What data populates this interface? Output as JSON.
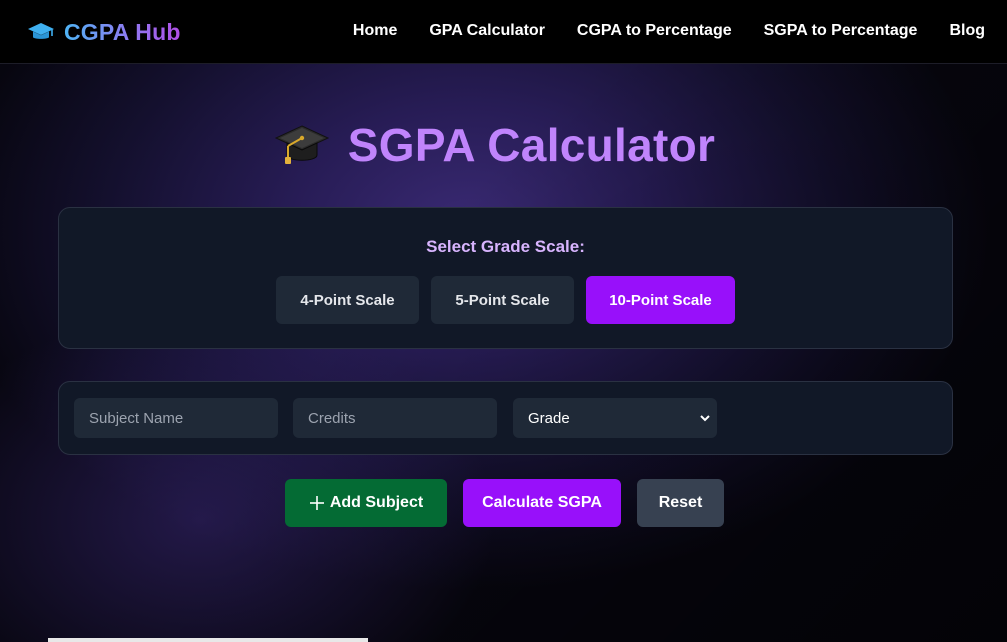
{
  "navbar": {
    "brand": "CGPA Hub",
    "brand_icon": "graduation-cap-icon",
    "links": [
      "Home",
      "GPA Calculator",
      "CGPA to Percentage",
      "SGPA to Percentage",
      "Blog"
    ]
  },
  "heading": {
    "icon": "graduation-cap-emoji-icon",
    "title": "SGPA Calculator"
  },
  "grade_scale": {
    "label": "Select Grade Scale:",
    "options": [
      "4-Point Scale",
      "5-Point Scale",
      "10-Point Scale"
    ],
    "selected": "10-Point Scale"
  },
  "subject_form": {
    "subject_placeholder": "Subject Name",
    "credits_placeholder": "Credits",
    "grade_selected": "Grade"
  },
  "actions": {
    "add_label": "Add Subject",
    "calculate_label": "Calculate SGPA",
    "reset_label": "Reset"
  },
  "colors": {
    "accent_purple": "#9810fa",
    "heading_purple": "#c084fc",
    "add_green": "#046b34",
    "card_bg": "#111827",
    "field_bg": "#1f2937"
  }
}
